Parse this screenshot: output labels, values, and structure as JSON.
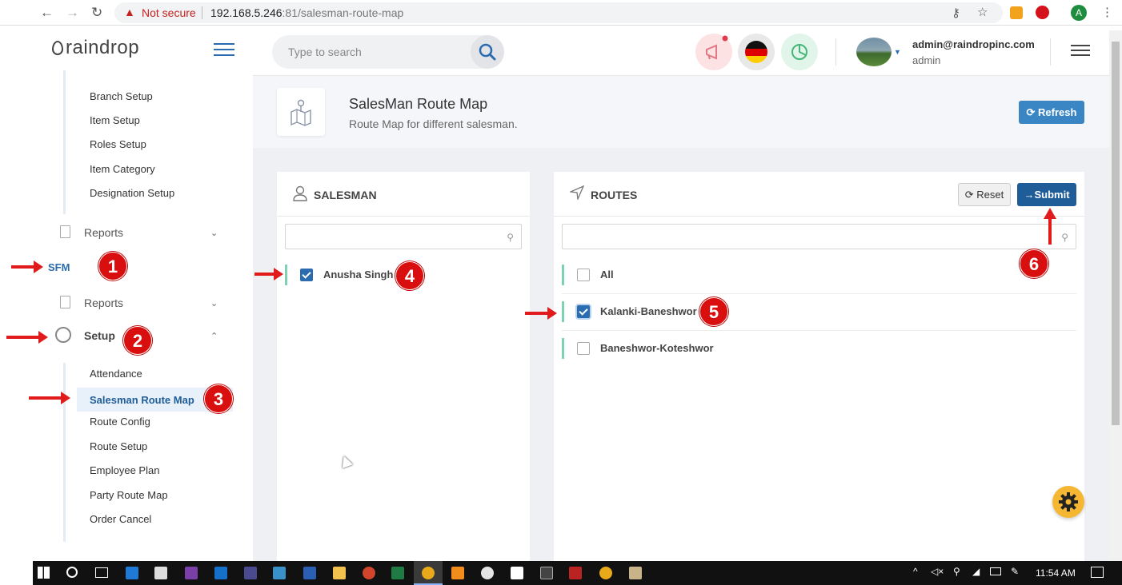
{
  "browser": {
    "security_label": "Not secure",
    "url_host": "192.168.5.246",
    "url_path": ":81/salesman-route-map",
    "profile_initial": "A"
  },
  "sidebar": {
    "logo": "raindrop",
    "items_top": [
      "Branch Setup",
      "Item Setup",
      "Roles Setup",
      "Item Category",
      "Designation Setup"
    ],
    "reports_1": "Reports",
    "sfm": "SFM",
    "reports_2": "Reports",
    "setup": "Setup",
    "setup_items": [
      "Attendance",
      "Salesman Route Map",
      "Route Config",
      "Route Setup",
      "Employee Plan",
      "Party Route Map",
      "Order Cancel"
    ]
  },
  "topbar": {
    "search_placeholder": "Type to search",
    "user_email": "admin@raindropinc.com",
    "user_role": "admin"
  },
  "page": {
    "title": "SalesMan Route Map",
    "subtitle": "Route Map for different salesman.",
    "refresh_label": "Refresh"
  },
  "salesman_panel": {
    "title": "SALESMAN",
    "rows": [
      {
        "label": "Anusha Singh",
        "checked": true
      }
    ]
  },
  "routes_panel": {
    "title": "ROUTES",
    "reset_label": "Reset",
    "submit_label": "Submit",
    "rows": [
      {
        "label": "All",
        "checked": false
      },
      {
        "label": "Kalanki-Baneshwor",
        "checked": true
      },
      {
        "label": "Baneshwor-Koteshwor",
        "checked": false
      }
    ]
  },
  "annotations": [
    "1",
    "2",
    "3",
    "4",
    "5",
    "6"
  ],
  "taskbar": {
    "time": "11:54 AM"
  },
  "colors": {
    "primary": "#1f5d99",
    "accent": "#7cd3b0",
    "annotation": "#e11b1b",
    "fab": "#f5b731"
  }
}
